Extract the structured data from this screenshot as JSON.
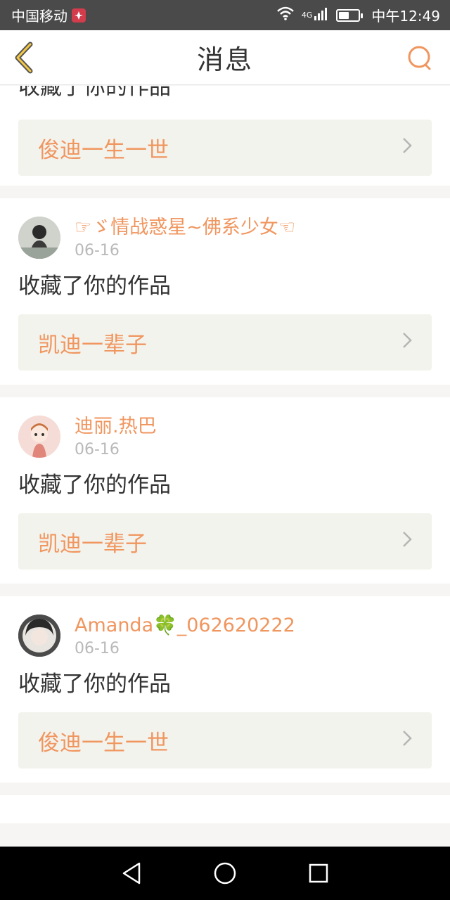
{
  "status_bar": {
    "carrier": "中国移动",
    "network": "4G",
    "battery_level": 0.55,
    "time": "中午12:49"
  },
  "header": {
    "title": "消息"
  },
  "colors": {
    "accent": "#f0965f",
    "header_bg": "#ffffff",
    "status_bg": "#4a4a4a",
    "nav_bg": "#000000",
    "link_bg": "#f3f3ed"
  },
  "notifications": [
    {
      "partial": true,
      "action": "收藏了你的作品",
      "work_title": "俊迪一生一世"
    },
    {
      "username": "☞ゞ情战惑星~佛系少女☜",
      "date": "06-16",
      "action": "收藏了你的作品",
      "work_title": "凯迪一辈子",
      "avatar_icon": "user-avatar-icon"
    },
    {
      "username": "迪丽.热巴",
      "date": "06-16",
      "action": "收藏了你的作品",
      "work_title": "凯迪一辈子",
      "avatar_icon": "user-avatar-icon"
    },
    {
      "username": "Amanda🍀_062620222",
      "date": "06-16",
      "action": "收藏了你的作品",
      "work_title": "俊迪一生一世",
      "avatar_icon": "user-avatar-icon"
    }
  ],
  "nav": {
    "back_icon": "triangle-back-icon",
    "home_icon": "circle-home-icon",
    "recent_icon": "square-recents-icon"
  }
}
